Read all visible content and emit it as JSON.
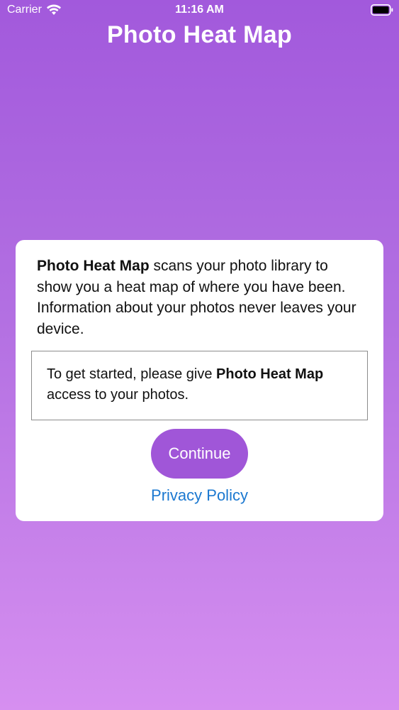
{
  "status_bar": {
    "carrier": "Carrier",
    "time": "11:16 AM",
    "wifi_icon": "wifi-icon",
    "battery_icon": "battery-icon"
  },
  "app": {
    "title": "Photo Heat Map"
  },
  "card": {
    "intro_app_name": "Photo Heat Map",
    "intro_text": " scans your photo library to show you a heat map of where you have been. Information about your photos never leaves your device.",
    "notice_prefix": "To get started, please give ",
    "notice_app_name": "Photo Heat Map",
    "notice_suffix": " access to your photos.",
    "continue_label": "Continue",
    "privacy_label": "Privacy Policy"
  },
  "colors": {
    "gradient_top": "#a259dc",
    "gradient_bottom": "#d68ff0",
    "button": "#a056d8",
    "link": "#1b78d0"
  }
}
